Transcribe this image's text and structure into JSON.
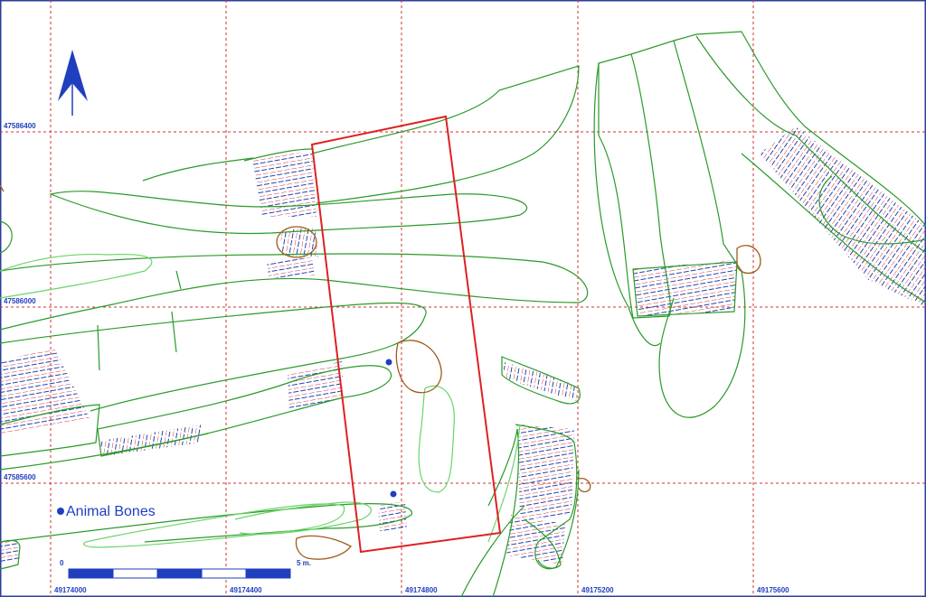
{
  "grid": {
    "x_labels": [
      "49174000",
      "49174400",
      "49174800",
      "49175200",
      "49175600"
    ],
    "y_labels": [
      "47586400",
      "47586000",
      "47585600"
    ],
    "color": "#cc3333"
  },
  "legend": {
    "animal_bones_label": "Animal Bones",
    "marker_color": "#1f3fbf"
  },
  "scale_bar": {
    "start_label": "0",
    "end_label": "5 m.",
    "segments": 5
  },
  "colors": {
    "feature_green": "#2a9a2a",
    "light_green": "#6ad46a",
    "excavation_red": "#dd2222",
    "pit_brown": "#a05a1a",
    "label_blue": "#1f3fbf",
    "hatch_blue": "#2244aa",
    "hatch_red": "#cc3344"
  },
  "icons": {
    "north_arrow": "north-arrow-icon"
  }
}
